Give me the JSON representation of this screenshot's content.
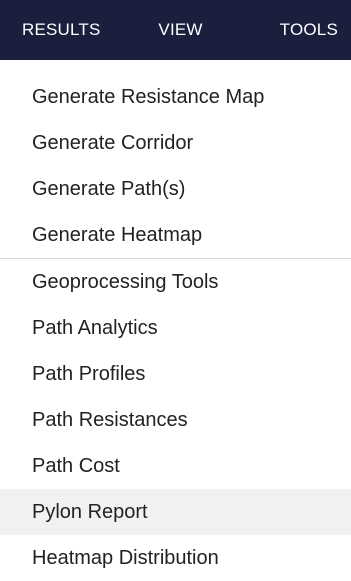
{
  "menubar": {
    "items": [
      {
        "label": "RESULTS"
      },
      {
        "label": "VIEW"
      },
      {
        "label": "TOOLS"
      }
    ]
  },
  "dropdown": {
    "group1": [
      {
        "label": "Generate Resistance Map"
      },
      {
        "label": "Generate Corridor"
      },
      {
        "label": "Generate Path(s)"
      },
      {
        "label": "Generate Heatmap"
      }
    ],
    "group2": [
      {
        "label": "Geoprocessing Tools"
      },
      {
        "label": "Path Analytics"
      },
      {
        "label": "Path Profiles"
      },
      {
        "label": "Path Resistances"
      },
      {
        "label": "Path Cost"
      },
      {
        "label": "Pylon Report"
      },
      {
        "label": "Heatmap Distribution"
      }
    ]
  },
  "colors": {
    "menubar_bg": "#1a1f3d",
    "hover_bg": "#f1f1f1"
  }
}
